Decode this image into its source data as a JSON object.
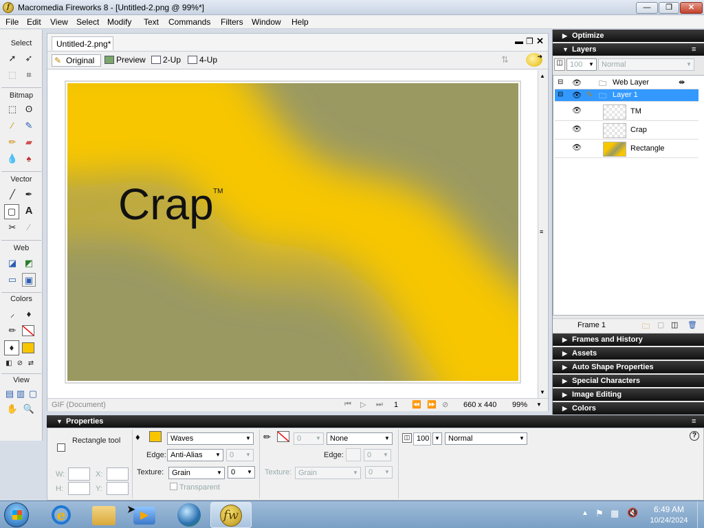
{
  "window": {
    "title": "Macromedia Fireworks 8 - [Untitled-2.png @ 99%*]",
    "app_icon_letter": "f",
    "buttons": {
      "minimize": "—",
      "restore": "❐",
      "close": "✕"
    }
  },
  "menu": [
    "File",
    "Edit",
    "View",
    "Select",
    "Modify",
    "Text",
    "Commands",
    "Filters",
    "Window",
    "Help"
  ],
  "tools": {
    "sections": [
      "Select",
      "Bitmap",
      "Vector",
      "Web",
      "Colors",
      "View"
    ]
  },
  "document": {
    "tab": "Untitled-2.png*",
    "views": {
      "original": "Original",
      "preview": "Preview",
      "two_up": "2-Up",
      "four_up": "4-Up"
    },
    "canvas_text": "Crap",
    "canvas_mark": "TM",
    "status": {
      "format": "GIF (Document)",
      "frame": "1",
      "size": "660 x 440",
      "zoom": "99%"
    }
  },
  "panels": {
    "optimize": "Optimize",
    "layers": {
      "title": "Layers",
      "opacity": "100",
      "blend": "Normal",
      "items": [
        {
          "name": "Web Layer",
          "kind": "folder"
        },
        {
          "name": "Layer 1",
          "kind": "folder",
          "selected": true
        },
        {
          "name": "TM",
          "kind": "object"
        },
        {
          "name": "Crap",
          "kind": "object"
        },
        {
          "name": "Rectangle",
          "kind": "object"
        }
      ],
      "frame_label": "Frame 1"
    },
    "collapsed": [
      "Frames and History",
      "Assets",
      "Auto Shape Properties",
      "Special Characters",
      "Image Editing",
      "Colors"
    ]
  },
  "properties": {
    "title": "Properties",
    "tool_name": "Rectangle tool",
    "w_label": "W:",
    "h_label": "H:",
    "x_label": "X:",
    "y_label": "Y:",
    "fill_type": "Waves",
    "edge_label": "Edge:",
    "edge_value": "Anti-Alias",
    "edge_num": "0",
    "texture_label": "Texture:",
    "texture_value": "Grain",
    "texture_num": "0",
    "transparent_label": "Transparent",
    "stroke_num": "0",
    "stroke_type": "None",
    "stroke_edge_label": "Edge:",
    "stroke_edge_num": "0",
    "stroke_texture_label": "Texture:",
    "stroke_texture_value": "Grain",
    "stroke_texture_num": "0",
    "opacity": "100",
    "blend": "Normal",
    "help": "?"
  },
  "taskbar": {
    "time": "6:49 AM",
    "date": "10/24/2024"
  },
  "colors": {
    "canvas_gold": "#f7c600",
    "canvas_olive": "#9a9962",
    "selection": "#3399ff"
  }
}
